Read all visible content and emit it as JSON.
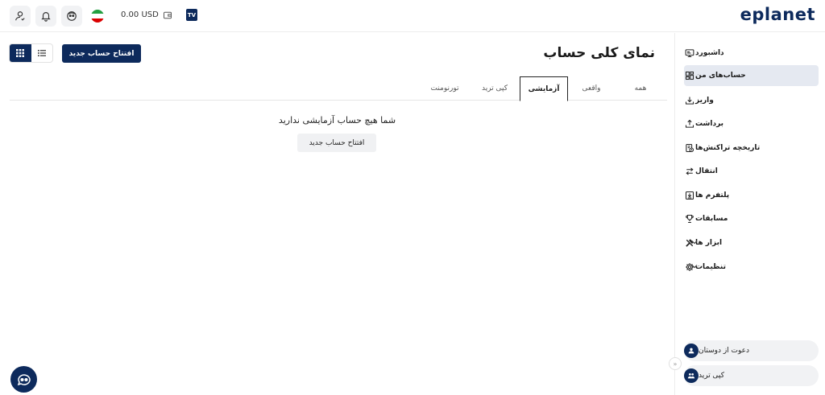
{
  "header": {
    "logo_text": "eplanet",
    "balance": "0.00 USD",
    "tv_badge": "TV",
    "icons": [
      "user-check-icon",
      "bell-icon",
      "avatar-icon",
      "iran-flag-icon",
      "wallet-icon",
      "tradingview-icon"
    ]
  },
  "sidebar": {
    "items": [
      {
        "label": "داشبورد",
        "icon": "monitor-icon"
      },
      {
        "label": "حساب‌های من",
        "icon": "grid-icon"
      },
      {
        "label": "واریز",
        "icon": "download-icon"
      },
      {
        "label": "برداشت",
        "icon": "upload-icon"
      },
      {
        "label": "تاریخچه تراکنش‌ها",
        "icon": "history-icon"
      },
      {
        "label": "انتقال",
        "icon": "transfer-icon"
      },
      {
        "label": "پلتفرم ها",
        "icon": "platform-icon"
      },
      {
        "label": "مسابقات",
        "icon": "trophy-icon"
      },
      {
        "label": "ابزار ها",
        "icon": "tools-icon"
      },
      {
        "label": "تنظیمات",
        "icon": "gear-icon"
      }
    ],
    "bottom": [
      {
        "label": "دعوت از دوستان",
        "icon": "invite-icon"
      },
      {
        "label": "کپی ترید",
        "icon": "copy-trade-icon"
      }
    ],
    "collapse_glyph": "«"
  },
  "main": {
    "title": "نمای کلی حساب",
    "new_account_button": "افتتاح حساب جدید",
    "tabs": [
      "همه",
      "واقعی",
      "آزمایشی",
      "کپی ترید",
      "تورنومنت"
    ],
    "active_tab": "آزمایشی",
    "empty_message": "شما هیچ حساب آزمایشی ندارید",
    "empty_button": "افتتاح حساب جدید"
  },
  "colors": {
    "brand": "#0d2a5c",
    "active_bg": "#e5e9f1",
    "button_secondary_bg": "#f0f1f3"
  }
}
